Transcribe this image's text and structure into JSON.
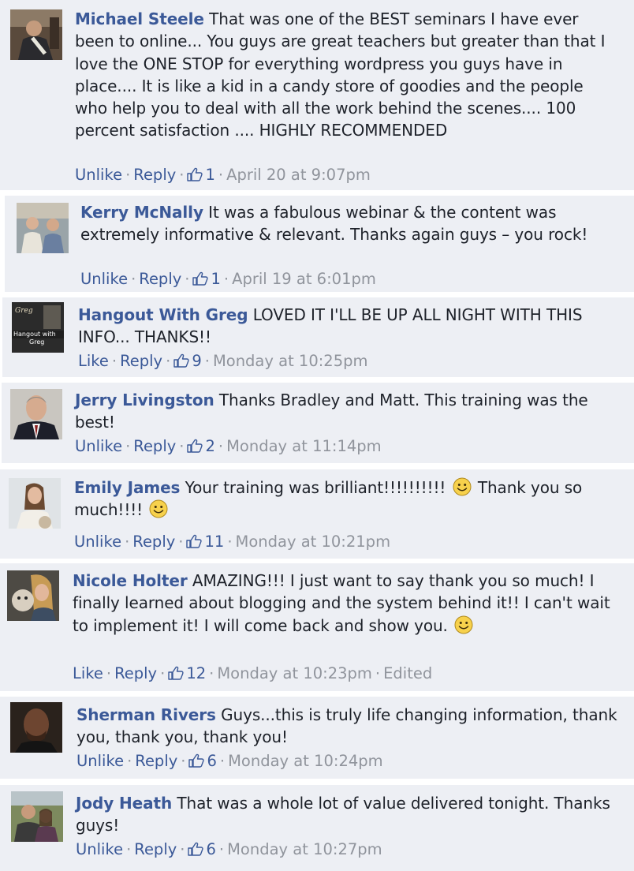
{
  "colors": {
    "comment_bg": "#edeff4",
    "author_link": "#3b5998",
    "meta_text": "#90949c",
    "body_text": "#1d2129"
  },
  "icons": {
    "like": "thumbs-up-icon",
    "emoticon": "smiley-icon"
  },
  "comments": [
    {
      "author": "Michael Steele",
      "text": "That was one of the BEST seminars I have ever been to online... You guys are great teachers but greater than that I love the ONE STOP for everything wordpress you guys have in place.... It is like a kid in a candy store of goodies and the people who help you to deal with all the work behind the scenes.... 100 percent satisfaction .... HIGHLY RECOMMENDED",
      "like_label": "Unlike",
      "reply_label": "Reply",
      "likes": "1",
      "timestamp": "April 20 at 9:07pm"
    },
    {
      "author": "Kerry McNally",
      "text": "It was a fabulous webinar & the content was extremely informative & relevant. Thanks again guys – you rock!",
      "like_label": "Unlike",
      "reply_label": "Reply",
      "likes": "1",
      "timestamp": "April 19 at 6:01pm"
    },
    {
      "author": "Hangout With Greg",
      "text": "LOVED IT I'LL BE UP ALL NIGHT WITH THIS INFO... THANKS!!",
      "like_label": "Like",
      "reply_label": "Reply",
      "likes": "9",
      "timestamp": "Monday at 10:25pm",
      "avatar_text": [
        "Greg",
        "Hangout with",
        "Greg"
      ]
    },
    {
      "author": "Jerry Livingston",
      "text": "Thanks Bradley and Matt. This training was the best!",
      "like_label": "Unlike",
      "reply_label": "Reply",
      "likes": "2",
      "timestamp": "Monday at 11:14pm"
    },
    {
      "author": "Emily James",
      "text_part1": "Your training was brilliant!!!!!!!!!!",
      "text_part2": "Thank you so much!!!!",
      "like_label": "Unlike",
      "reply_label": "Reply",
      "likes": "11",
      "timestamp": "Monday at 10:21pm"
    },
    {
      "author": "Nicole Holter",
      "text": "AMAZING!!! I just want to say thank you so much! I finally learned about blogging and the system behind it!! I can't wait to implement it! I will come back and show you.",
      "like_label": "Like",
      "reply_label": "Reply",
      "likes": "12",
      "timestamp": "Monday at 10:23pm",
      "edited": "Edited"
    },
    {
      "author": "Sherman Rivers",
      "text": "Guys...this is truly life changing information, thank you, thank you, thank you!",
      "like_label": "Unlike",
      "reply_label": "Reply",
      "likes": "6",
      "timestamp": "Monday at 10:24pm"
    },
    {
      "author": "Jody Heath",
      "text": "That was a whole lot of value delivered tonight. Thanks guys!",
      "like_label": "Unlike",
      "reply_label": "Reply",
      "likes": "6",
      "timestamp": "Monday at 10:27pm"
    }
  ],
  "separator": "·"
}
